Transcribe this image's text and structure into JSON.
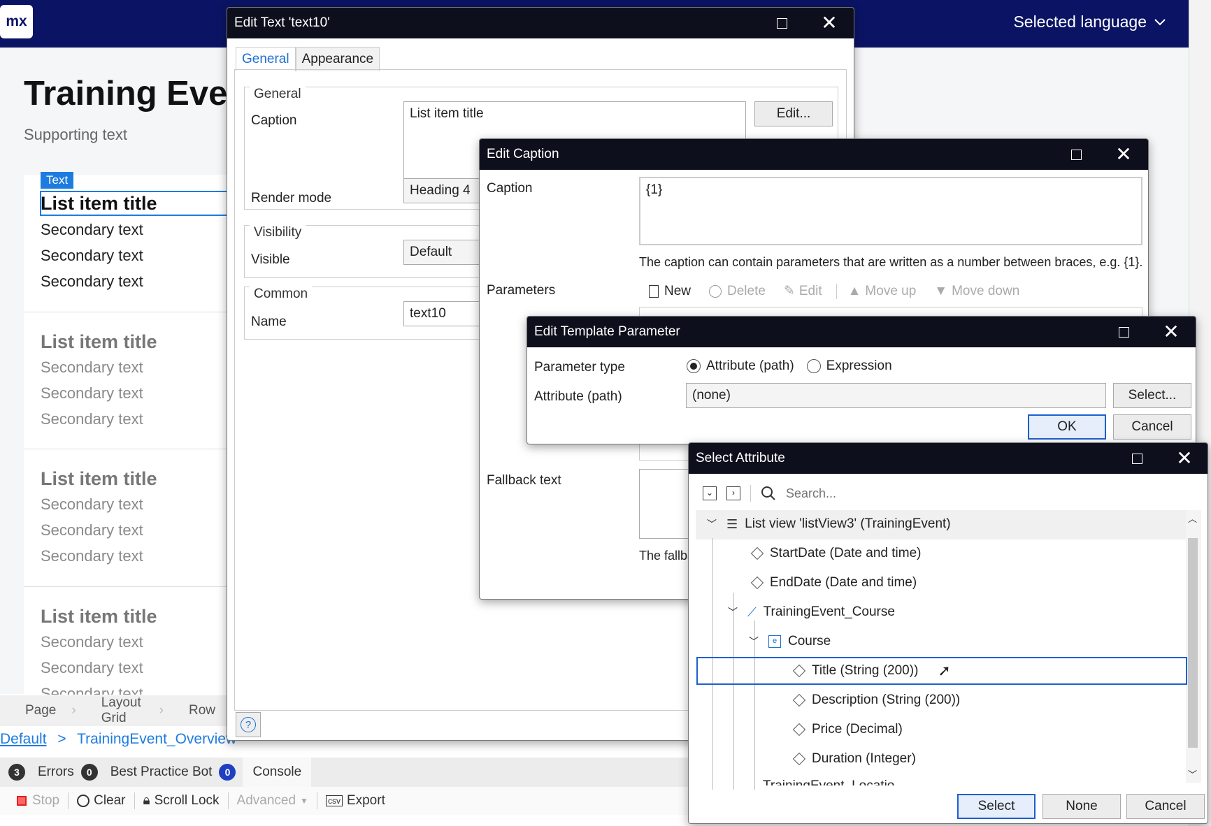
{
  "topbar": {
    "logo": "mx",
    "language_label": "Selected language"
  },
  "page": {
    "title": "Training Even",
    "supporting": "Supporting text",
    "selection_badge": "Text",
    "groups": [
      {
        "title": "List item title",
        "secondary": [
          "Secondary text",
          "Secondary text",
          "Secondary text"
        ]
      },
      {
        "title": "List item title",
        "secondary": [
          "Secondary text",
          "Secondary text",
          "Secondary text"
        ]
      },
      {
        "title": "List item title",
        "secondary": [
          "Secondary text",
          "Secondary text",
          "Secondary text"
        ]
      },
      {
        "title": "List item title",
        "secondary": [
          "Secondary text",
          "Secondary text",
          "Secondary text"
        ]
      }
    ]
  },
  "crumbs": [
    "Page",
    "Layout Grid",
    "Row"
  ],
  "navpath": {
    "root": "Default",
    "sep": ">",
    "page": "TrainingEvent_Overview"
  },
  "bottom_tabs": {
    "errors_count": "3",
    "errors": "Errors",
    "bp_count": "0",
    "bp": "Best Practice Bot",
    "bp_badge": "0",
    "console": "Console"
  },
  "console_tools": {
    "stop": "Stop",
    "clear": "Clear",
    "scroll_lock": "Scroll Lock",
    "advanced": "Advanced",
    "export": "Export"
  },
  "edit_text": {
    "title": "Edit Text 'text10'",
    "tabs": [
      "General",
      "Appearance"
    ],
    "general_group": "General",
    "caption_label": "Caption",
    "caption_value": "List item title",
    "edit_button": "Edit...",
    "render_label": "Render mode",
    "render_value": "Heading 4",
    "visibility_group": "Visibility",
    "visible_label": "Visible",
    "visible_value": "Default",
    "common_group": "Common",
    "name_label": "Name",
    "name_value": "text10",
    "help": "?"
  },
  "edit_caption": {
    "title": "Edit Caption",
    "caption_label": "Caption",
    "caption_value": "{1}",
    "hint": "The caption can contain parameters that are written as a number between braces, e.g. {1}.",
    "parameters_label": "Parameters",
    "toolbar": {
      "new": "New",
      "delete": "Delete",
      "edit": "Edit",
      "move_up": "Move up",
      "move_down": "Move down"
    },
    "fallback_label": "Fallback text",
    "fallback_hint": "The fallba"
  },
  "edit_param": {
    "title": "Edit Template Parameter",
    "type_label": "Parameter type",
    "opt_attr": "Attribute (path)",
    "opt_expr": "Expression",
    "attr_label": "Attribute (path)",
    "attr_value": "(none)",
    "select_button": "Select...",
    "ok": "OK",
    "cancel": "Cancel"
  },
  "select_attr": {
    "title": "Select Attribute",
    "search_placeholder": "Search...",
    "tree": {
      "root": "List view 'listView3' (TrainingEvent)",
      "start": "StartDate (Date and time)",
      "end": "EndDate (Date and time)",
      "assoc": "TrainingEvent_Course",
      "entity": "Course",
      "title": "Title (String (200))",
      "desc": "Description (String (200))",
      "price": "Price (Decimal)",
      "duration": "Duration (Integer)",
      "cut": "TrainingEvent_Locatio"
    },
    "select": "Select",
    "none": "None",
    "cancel": "Cancel"
  }
}
